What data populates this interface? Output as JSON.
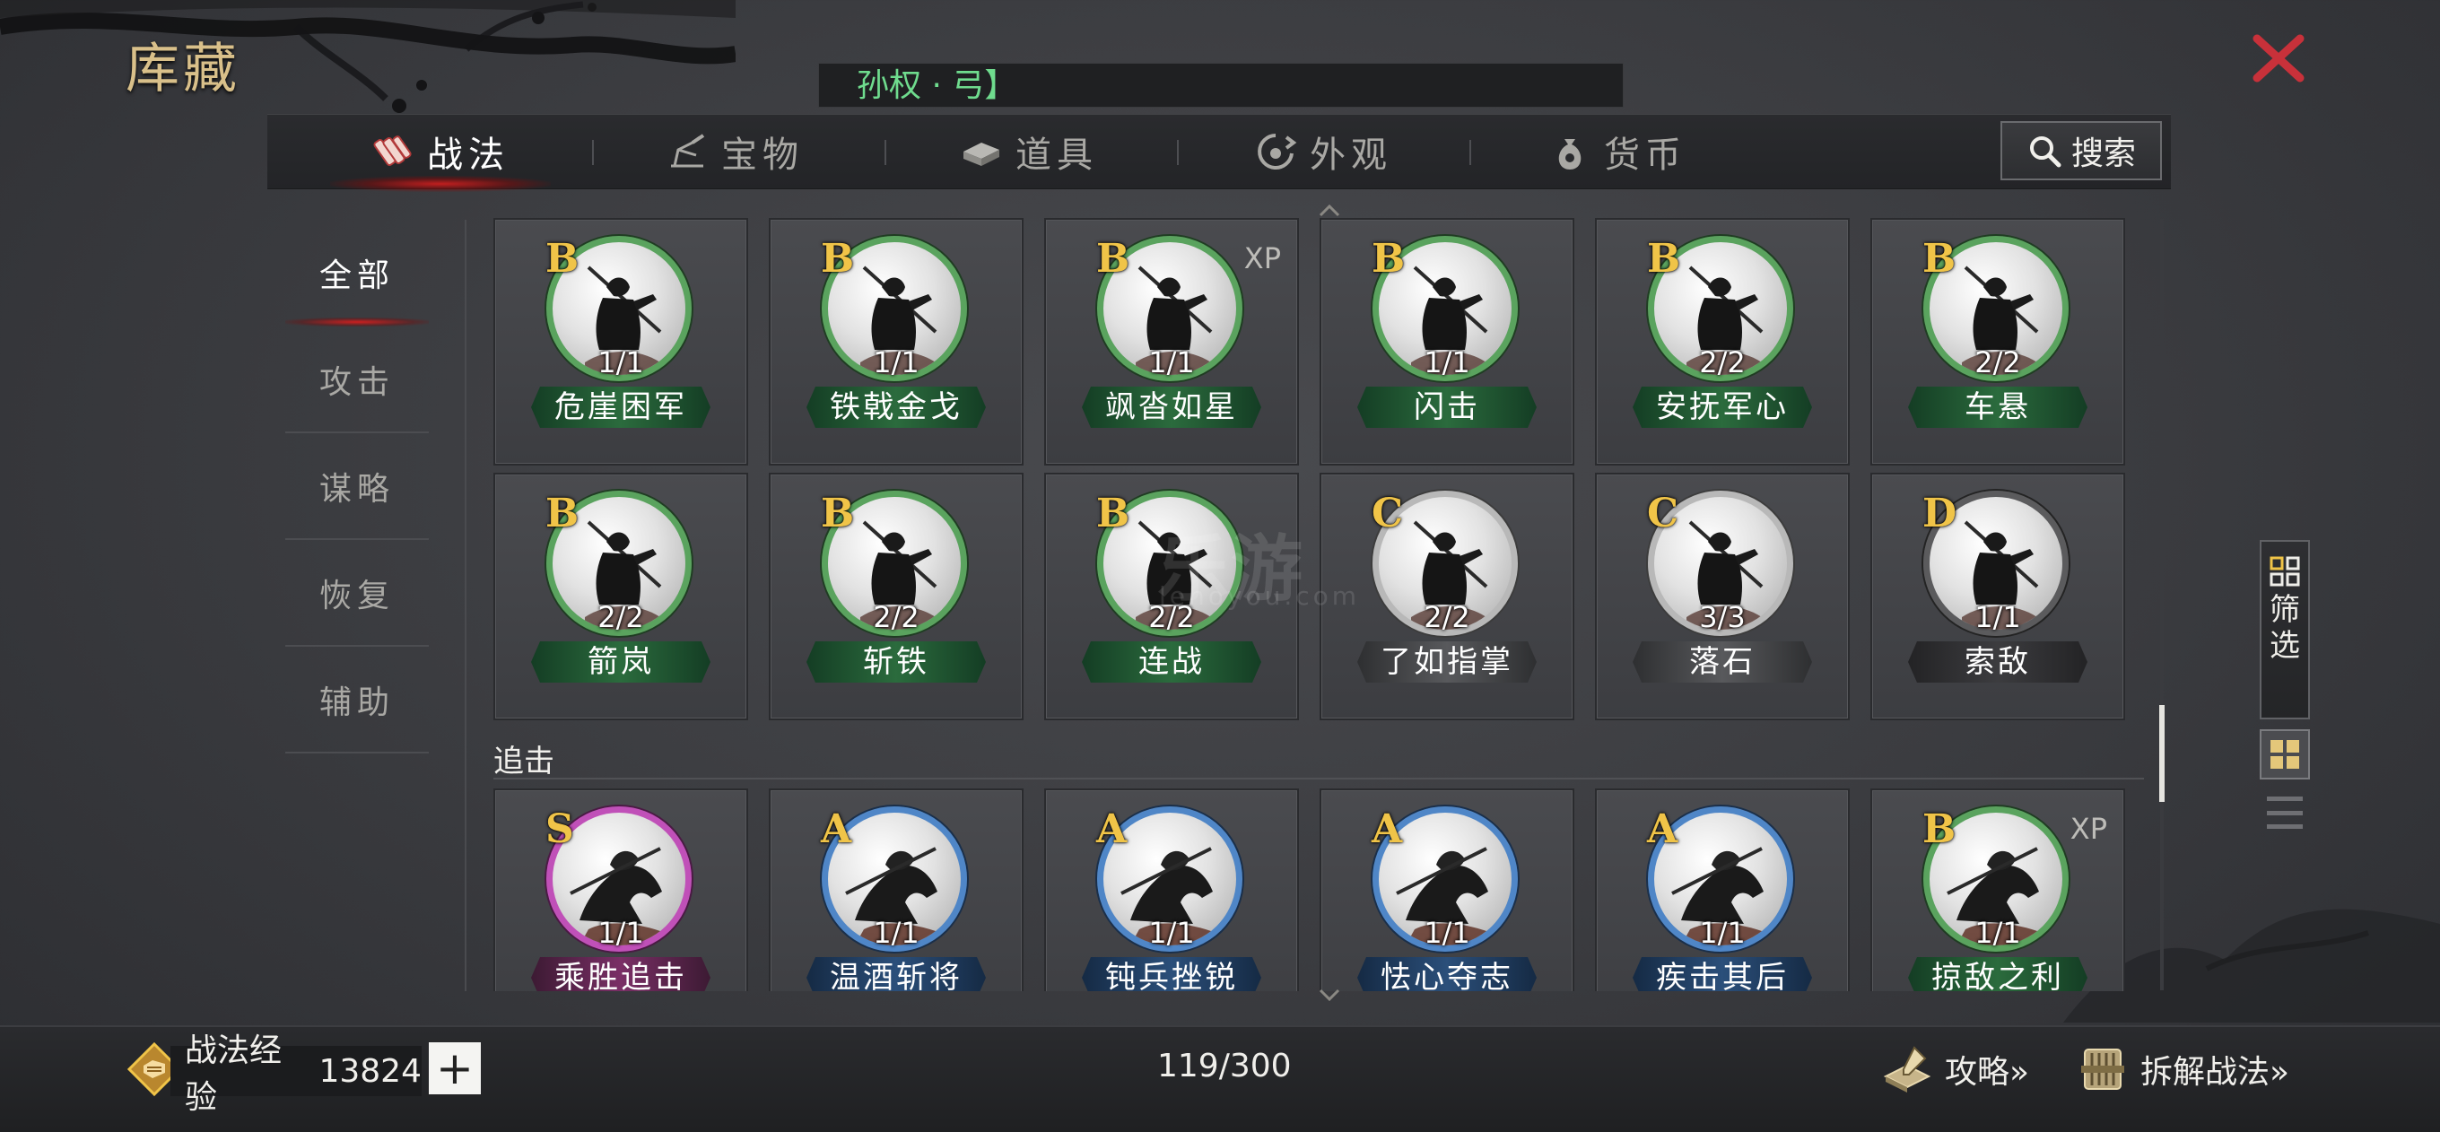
{
  "window": {
    "title": "库藏"
  },
  "hero_filter": {
    "text": "孙权 · 弓】"
  },
  "tabs": [
    {
      "label": "战法",
      "icon": "scroll-icon",
      "active": true
    },
    {
      "label": "宝物",
      "icon": "treasure-icon",
      "active": false
    },
    {
      "label": "道具",
      "icon": "item-box-icon",
      "active": false
    },
    {
      "label": "外观",
      "icon": "appearance-icon",
      "active": false
    },
    {
      "label": "货币",
      "icon": "money-bag-icon",
      "active": false
    }
  ],
  "search": {
    "label": "搜索"
  },
  "sidebar": {
    "items": [
      {
        "label": "全部",
        "active": true
      },
      {
        "label": "攻击",
        "active": false
      },
      {
        "label": "谋略",
        "active": false
      },
      {
        "label": "恢复",
        "active": false
      },
      {
        "label": "辅助",
        "active": false
      }
    ]
  },
  "grid": {
    "row1": [
      {
        "grade": "B",
        "count": "1/1",
        "name": "危崖困军",
        "rarity": "green",
        "xp": ""
      },
      {
        "grade": "B",
        "count": "1/1",
        "name": "铁戟金戈",
        "rarity": "green",
        "xp": ""
      },
      {
        "grade": "B",
        "count": "1/1",
        "name": "飒沓如星",
        "rarity": "green",
        "xp": "XP"
      },
      {
        "grade": "B",
        "count": "1/1",
        "name": "闪击",
        "rarity": "green",
        "xp": ""
      },
      {
        "grade": "B",
        "count": "2/2",
        "name": "安抚军心",
        "rarity": "green",
        "xp": ""
      },
      {
        "grade": "B",
        "count": "2/2",
        "name": "车悬",
        "rarity": "green",
        "xp": ""
      }
    ],
    "row2": [
      {
        "grade": "B",
        "count": "2/2",
        "name": "箭岚",
        "rarity": "green",
        "xp": ""
      },
      {
        "grade": "B",
        "count": "2/2",
        "name": "斩铁",
        "rarity": "green",
        "xp": ""
      },
      {
        "grade": "B",
        "count": "2/2",
        "name": "连战",
        "rarity": "green",
        "xp": ""
      },
      {
        "grade": "C",
        "count": "2/2",
        "name": "了如指掌",
        "rarity": "gray",
        "xp": ""
      },
      {
        "grade": "C",
        "count": "3/3",
        "name": "落石",
        "rarity": "gray",
        "xp": ""
      },
      {
        "grade": "D",
        "count": "1/1",
        "name": "索敌",
        "rarity": "dgray",
        "xp": ""
      }
    ],
    "section_label": "追击",
    "row3": [
      {
        "grade": "S",
        "count": "1/1",
        "name": "乘胜追击",
        "rarity": "pink",
        "xp": ""
      },
      {
        "grade": "A",
        "count": "1/1",
        "name": "温酒斩将",
        "rarity": "blue",
        "xp": ""
      },
      {
        "grade": "A",
        "count": "1/1",
        "name": "钝兵挫锐",
        "rarity": "blue",
        "xp": ""
      },
      {
        "grade": "A",
        "count": "1/1",
        "name": "怯心夺志",
        "rarity": "blue",
        "xp": ""
      },
      {
        "grade": "A",
        "count": "1/1",
        "name": "疾击其后",
        "rarity": "blue",
        "xp": ""
      },
      {
        "grade": "B",
        "count": "1/1",
        "name": "掠敌之利",
        "rarity": "green",
        "xp": "XP"
      }
    ]
  },
  "filter_button": {
    "label": "筛选"
  },
  "bottom": {
    "exp_label": "战法经验",
    "exp_value": "13824",
    "plus": "+",
    "capacity": "119/300",
    "guide_label": "攻略»",
    "decompose_label": "拆解战法»"
  },
  "watermark": {
    "text": "乐游",
    "sub": "lehoyou.com"
  },
  "colors": {
    "accent_red": "#c41e1e",
    "grade_gold": "#f0c448",
    "hero_filter_green": "#6fdc8e",
    "title_gold": "#d9c08a"
  }
}
